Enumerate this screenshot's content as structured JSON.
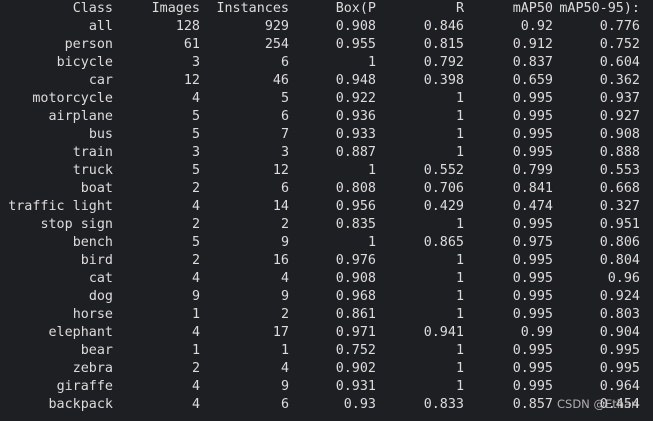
{
  "table": {
    "headers": [
      "Class",
      "Images",
      "Instances",
      "Box(P",
      "R",
      "mAP50",
      "mAP50-95):"
    ],
    "rows": [
      [
        "all",
        "128",
        "929",
        "0.908",
        "0.846",
        "0.92",
        "0.776"
      ],
      [
        "person",
        "61",
        "254",
        "0.955",
        "0.815",
        "0.912",
        "0.752"
      ],
      [
        "bicycle",
        "3",
        "6",
        "1",
        "0.792",
        "0.837",
        "0.604"
      ],
      [
        "car",
        "12",
        "46",
        "0.948",
        "0.398",
        "0.659",
        "0.362"
      ],
      [
        "motorcycle",
        "4",
        "5",
        "0.922",
        "1",
        "0.995",
        "0.937"
      ],
      [
        "airplane",
        "5",
        "6",
        "0.936",
        "1",
        "0.995",
        "0.927"
      ],
      [
        "bus",
        "5",
        "7",
        "0.933",
        "1",
        "0.995",
        "0.908"
      ],
      [
        "train",
        "3",
        "3",
        "0.887",
        "1",
        "0.995",
        "0.888"
      ],
      [
        "truck",
        "5",
        "12",
        "1",
        "0.552",
        "0.799",
        "0.553"
      ],
      [
        "boat",
        "2",
        "6",
        "0.808",
        "0.706",
        "0.841",
        "0.668"
      ],
      [
        "traffic light",
        "4",
        "14",
        "0.956",
        "0.429",
        "0.474",
        "0.327"
      ],
      [
        "stop sign",
        "2",
        "2",
        "0.835",
        "1",
        "0.995",
        "0.951"
      ],
      [
        "bench",
        "5",
        "9",
        "1",
        "0.865",
        "0.975",
        "0.806"
      ],
      [
        "bird",
        "2",
        "16",
        "0.976",
        "1",
        "0.995",
        "0.804"
      ],
      [
        "cat",
        "4",
        "4",
        "0.908",
        "1",
        "0.995",
        "0.96"
      ],
      [
        "dog",
        "9",
        "9",
        "0.968",
        "1",
        "0.995",
        "0.924"
      ],
      [
        "horse",
        "1",
        "2",
        "0.861",
        "1",
        "0.995",
        "0.803"
      ],
      [
        "elephant",
        "4",
        "17",
        "0.971",
        "0.941",
        "0.99",
        "0.904"
      ],
      [
        "bear",
        "1",
        "1",
        "0.752",
        "1",
        "0.995",
        "0.995"
      ],
      [
        "zebra",
        "2",
        "4",
        "0.902",
        "1",
        "0.995",
        "0.995"
      ],
      [
        "giraffe",
        "4",
        "9",
        "0.931",
        "1",
        "0.995",
        "0.964"
      ],
      [
        "backpack",
        "4",
        "6",
        "0.93",
        "0.833",
        "0.857",
        "0.454"
      ]
    ]
  },
  "watermark": "CSDN @Ethan"
}
